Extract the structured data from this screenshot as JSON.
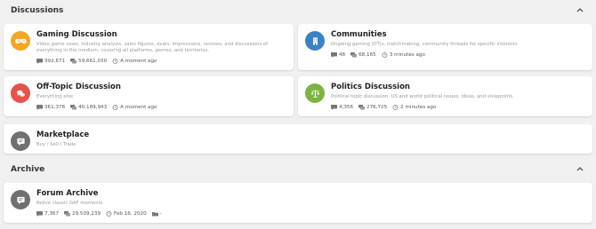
{
  "sections": {
    "discussions": {
      "title": "Discussions"
    },
    "archive": {
      "title": "Archive"
    }
  },
  "colors": {
    "gaming": "#f5a623",
    "communities": "#3b82c4",
    "offtopic": "#e5534b",
    "politics": "#7cb342",
    "neutral": "#707070"
  },
  "forums": {
    "gaming": {
      "title": "Gaming Discussion",
      "desc": "Video game news, industry analysis, sales figures, deals, impressions, reviews, and discussions of everything in the medium, covering all platforms, genres, and territories.",
      "threads": "392,671",
      "posts": "59,661,030",
      "last": "A moment ago",
      "icon": "gamepad-icon"
    },
    "communities": {
      "title": "Communities",
      "desc": "Ongoing gaming |OT|s, matchmaking, community threads for specific interests",
      "threads": "48",
      "posts": "68,165",
      "last": "3 minutes ago",
      "icon": "building-icon"
    },
    "offtopic": {
      "title": "Off-Topic Discussion",
      "desc": "Everything else",
      "threads": "361,376",
      "posts": "40,189,943",
      "last": "A moment ago",
      "icon": "chat-bubbles-icon"
    },
    "politics": {
      "title": "Politics Discussion",
      "desc": "Political topic discussion. US and world political issues, ideas, and viewpoints.",
      "threads": "4,356",
      "posts": "276,725",
      "last": "2 minutes ago",
      "icon": "scales-icon"
    },
    "marketplace": {
      "title": "Marketplace",
      "desc": "Buy / Sell / Trade",
      "icon": "message-icon"
    },
    "archive": {
      "title": "Forum Archive",
      "desc": "Relive classic GAF moments",
      "threads": "7,367",
      "posts": "29,509,239",
      "last": "Feb 16, 2020",
      "extra": "-",
      "icon": "message-icon"
    }
  }
}
